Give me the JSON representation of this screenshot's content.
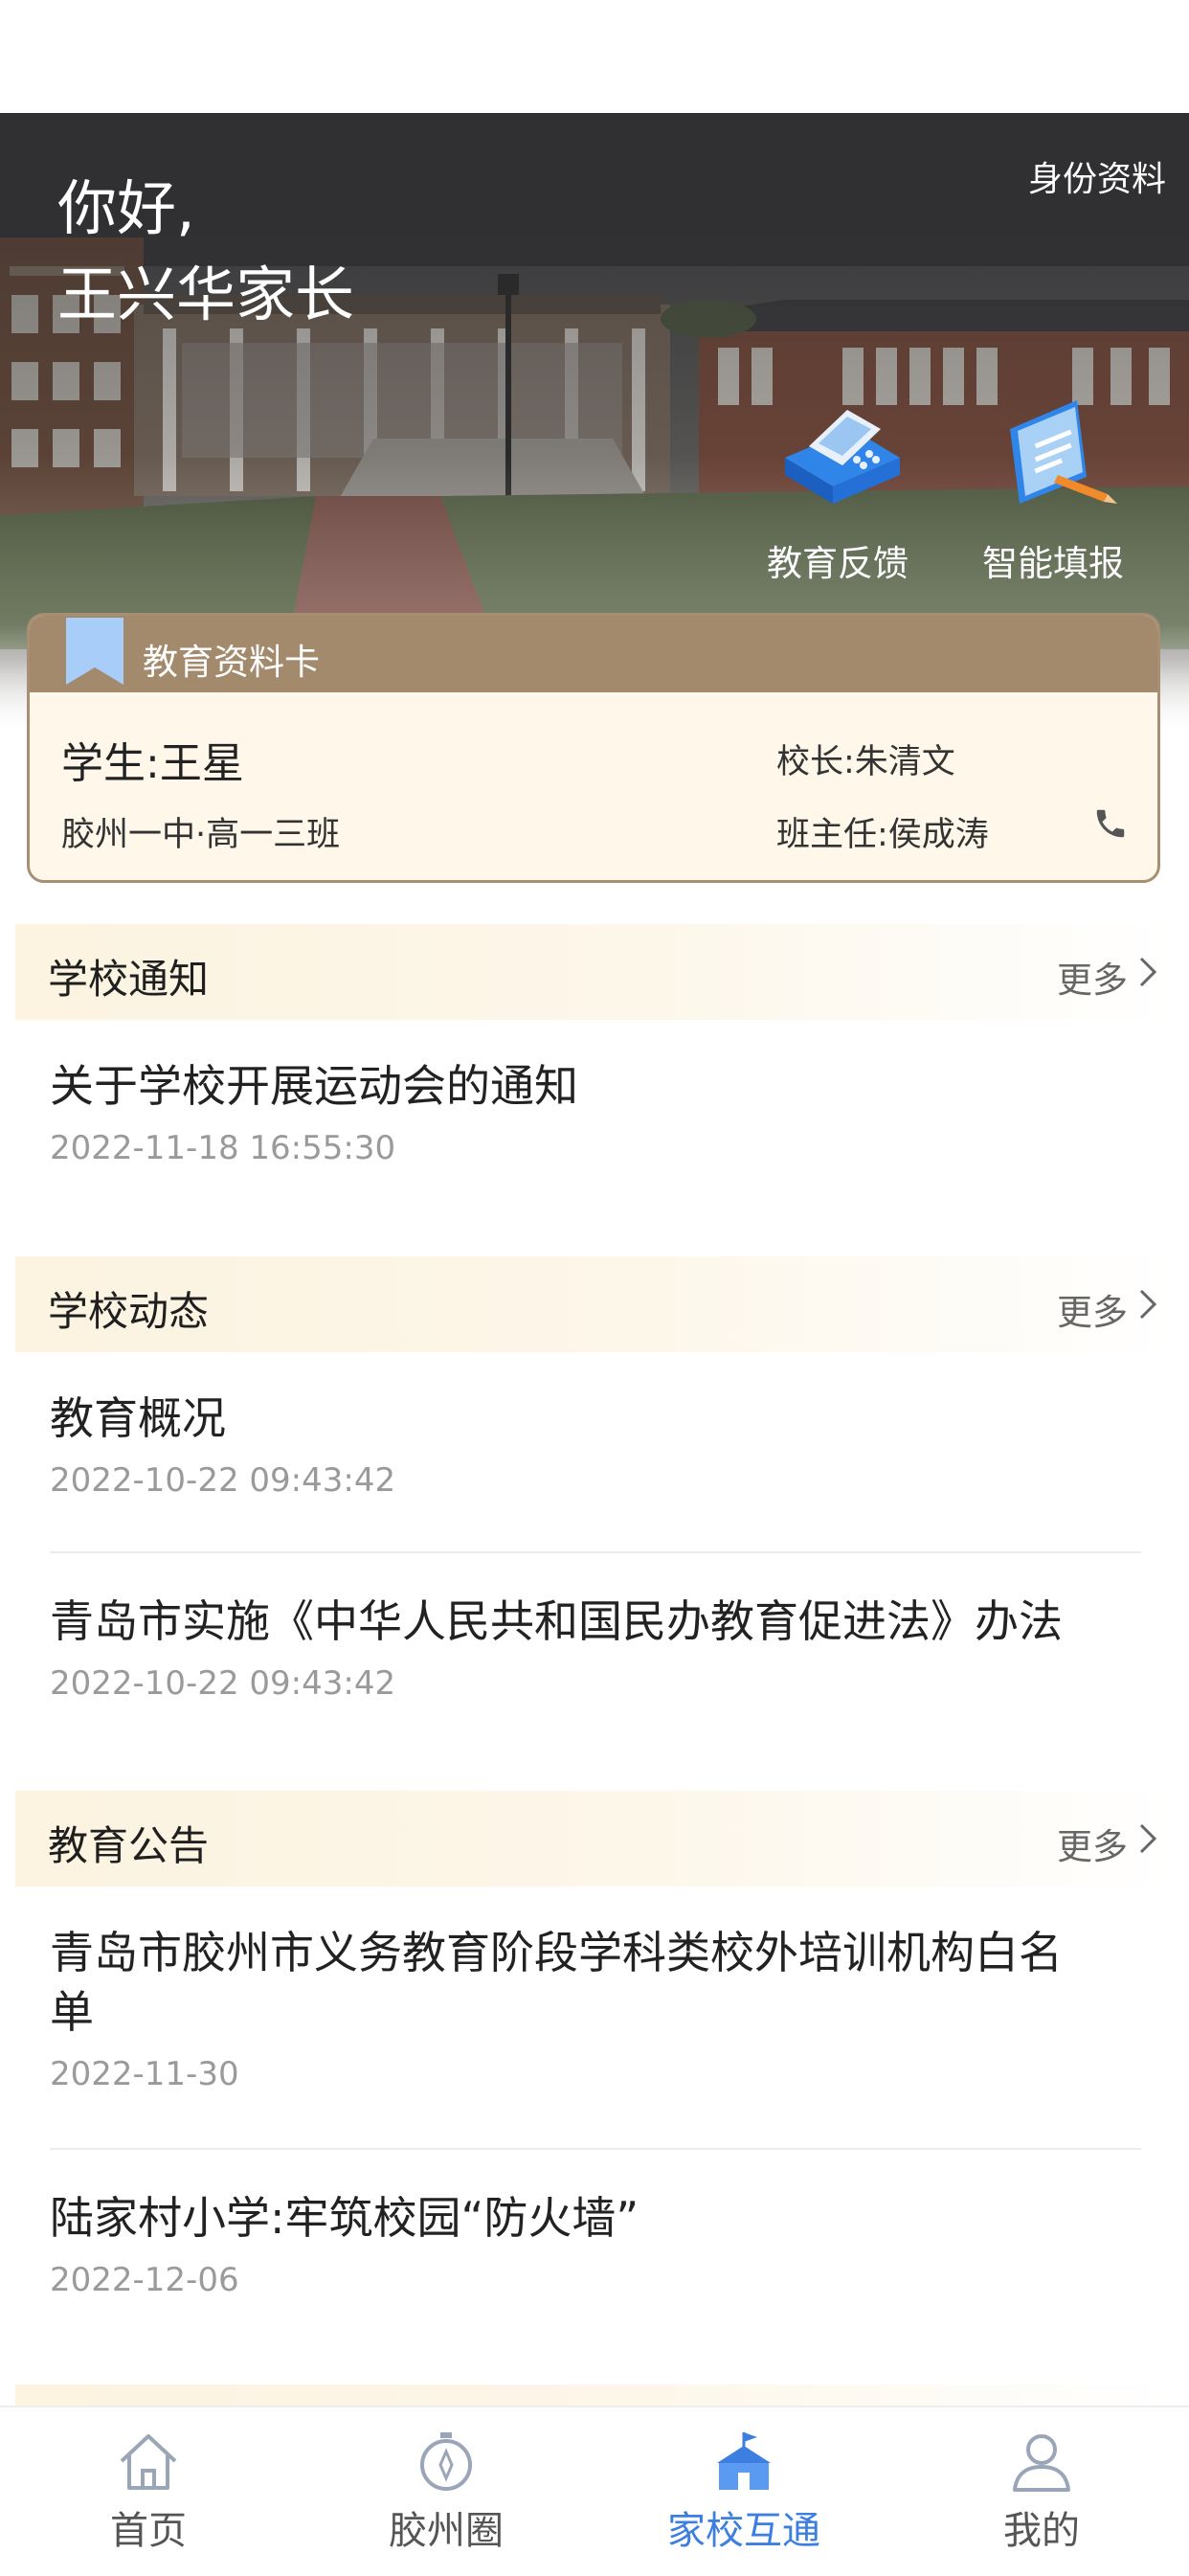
{
  "hero": {
    "greeting_line1": "你好,",
    "greeting_line2": "王兴华家长",
    "identity_link": "身份资料",
    "actions": [
      {
        "label": "教育反馈",
        "icon": "fax-machine-icon"
      },
      {
        "label": "智能填报",
        "icon": "report-pencil-icon"
      }
    ]
  },
  "card": {
    "title": "教育资料卡",
    "student": "学生:王星",
    "school_class": "胶州一中·高一三班",
    "principal": "校长:朱清文",
    "head_teacher": "班主任:侯成涛"
  },
  "sections": {
    "notice": {
      "title": "学校通知",
      "more": "更多",
      "items": [
        {
          "title": "关于学校开展运动会的通知",
          "date": "2022-11-18 16:55:30"
        }
      ]
    },
    "news": {
      "title": "学校动态",
      "more": "更多",
      "items": [
        {
          "title": "教育概况",
          "date": "2022-10-22 09:43:42"
        },
        {
          "title": "青岛市实施《中华人民共和国民办教育促进法》办法",
          "date": "2022-10-22 09:43:42"
        }
      ]
    },
    "announce": {
      "title": "教育公告",
      "more": "更多",
      "items": [
        {
          "title_line1": "青岛市胶州市义务教育阶段学科类校外培训机构白名",
          "title_line2": "单",
          "date": "2022-11-30"
        },
        {
          "title": "陆家村小学:牢筑校园“防火墙”",
          "date": "2022-12-06"
        }
      ]
    }
  },
  "tabbar": {
    "tabs": [
      {
        "label": "首页",
        "icon": "home-icon",
        "active": false
      },
      {
        "label": "胶州圈",
        "icon": "compass-icon",
        "active": false
      },
      {
        "label": "家校互通",
        "icon": "school-icon",
        "active": true
      },
      {
        "label": "我的",
        "icon": "user-icon",
        "active": false
      }
    ]
  },
  "colors": {
    "accent": "#3d7fe0",
    "card_header": "#a48a6d",
    "card_body": "#fff8ea",
    "section_bg": "#fcf3e0"
  }
}
